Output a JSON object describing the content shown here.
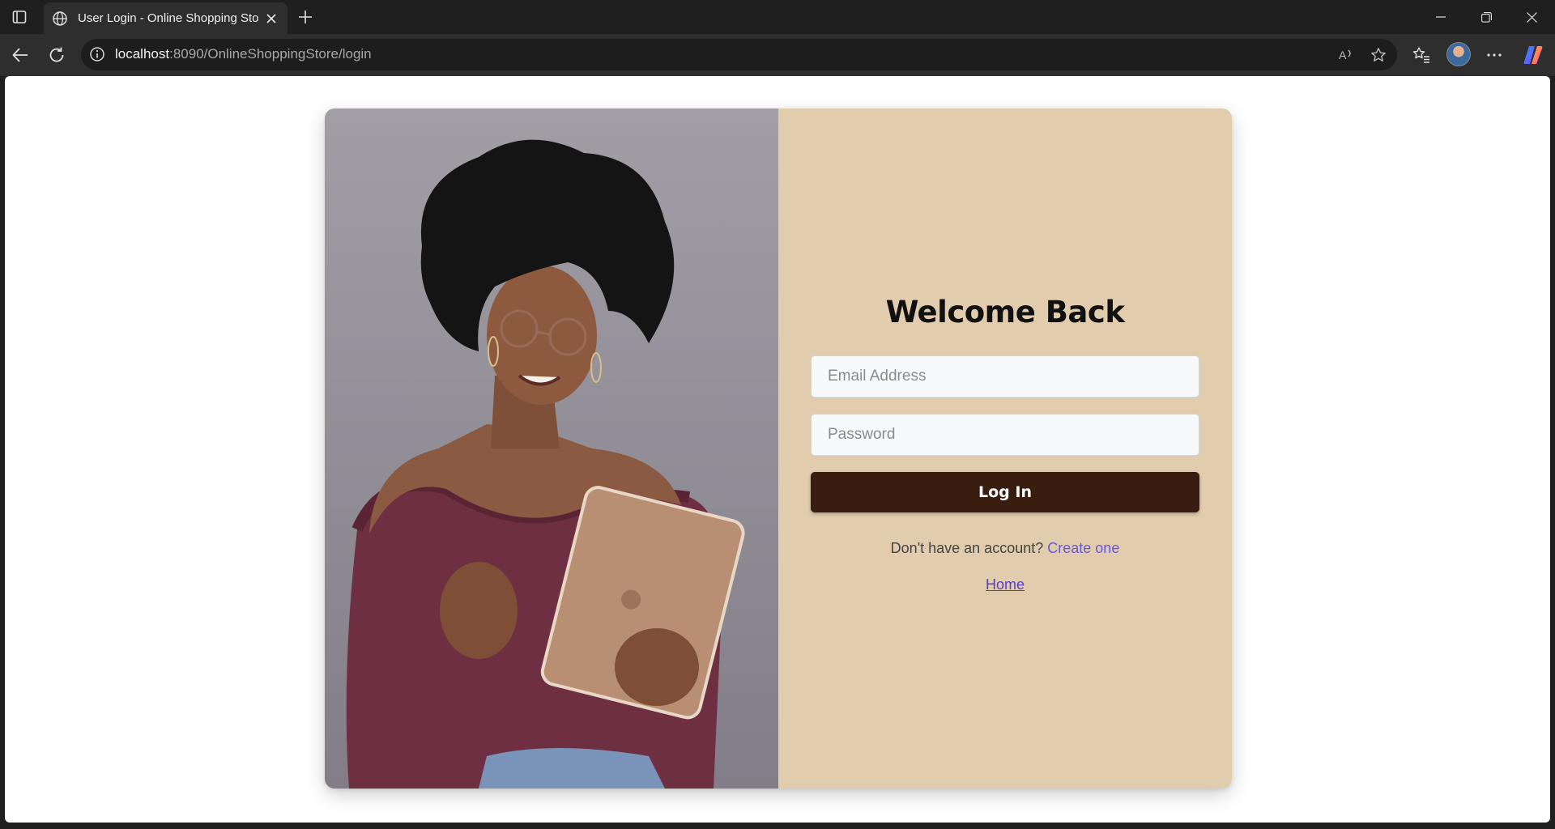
{
  "browser": {
    "tab_title": "User Login - Online Shopping Store",
    "url_host": "localhost",
    "url_path": ":8090/OnlineShoppingStore/login"
  },
  "login": {
    "heading": "Welcome Back",
    "email_placeholder": "Email Address",
    "password_placeholder": "Password",
    "login_label": "Log In",
    "signup_prompt": "Don't have an account?",
    "signup_link": "Create one",
    "home_link": "Home"
  },
  "colors": {
    "panel_bg": "#e1cdae",
    "button_bg": "#391d10",
    "link": "#6a57d6"
  }
}
